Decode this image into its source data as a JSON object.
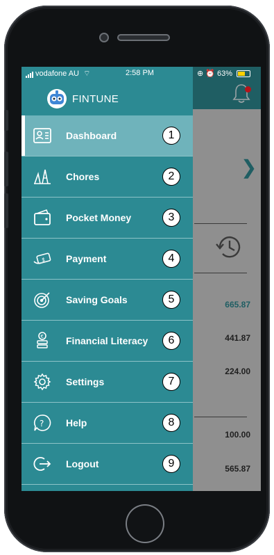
{
  "status_bar": {
    "carrier": "vodafone AU",
    "time": "2:58 PM",
    "battery_percent": "63%",
    "battery_level": 0.63
  },
  "app": {
    "brand": "FINTUNE",
    "brand_color": "#2c8a93",
    "active_color": "#6fb3bb"
  },
  "menu": {
    "items": [
      {
        "label": "Dashboard",
        "number": "1",
        "icon": "dashboard-icon",
        "active": true
      },
      {
        "label": "Chores",
        "number": "2",
        "icon": "chores-icon"
      },
      {
        "label": "Pocket Money",
        "number": "3",
        "icon": "wallet-icon"
      },
      {
        "label": "Payment",
        "number": "4",
        "icon": "payment-icon"
      },
      {
        "label": "Saving Goals",
        "number": "5",
        "icon": "target-icon"
      },
      {
        "label": "Financial Literacy",
        "number": "6",
        "icon": "coins-icon"
      },
      {
        "label": "Settings",
        "number": "7",
        "icon": "gear-icon"
      },
      {
        "label": "Help",
        "number": "8",
        "icon": "help-icon"
      },
      {
        "label": "Logout",
        "number": "9",
        "icon": "logout-icon"
      }
    ]
  },
  "background": {
    "values": [
      "665.87",
      "441.87",
      "224.00",
      "100.00",
      "565.87"
    ],
    "highlight_color": "#1f5e63"
  }
}
